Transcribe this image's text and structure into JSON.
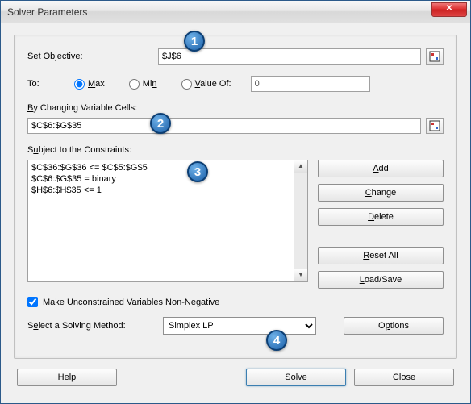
{
  "window": {
    "title": "Solver Parameters"
  },
  "objective": {
    "label": "Set Objective:",
    "value": "$J$6"
  },
  "to": {
    "label": "To:",
    "max_label": "Max",
    "min_label": "Min",
    "valueof_label": "Value Of:",
    "valueof_value": "0"
  },
  "changing": {
    "label": "By Changing Variable Cells:",
    "value": "$C$6:$G$35"
  },
  "constraints": {
    "label": "Subject to the Constraints:",
    "items": [
      "$C$36:$G$36 <= $C$5:$G$5",
      "$C$6:$G$35 = binary",
      "$H$6:$H$35 <= 1"
    ]
  },
  "buttons": {
    "add": "Add",
    "change": "Change",
    "delete": "Delete",
    "resetall": "Reset All",
    "loadsave": "Load/Save",
    "options": "Options",
    "help": "Help",
    "solve": "Solve",
    "close": "Close"
  },
  "nonneg": {
    "label": "Make Unconstrained Variables Non-Negative",
    "checked": true
  },
  "method": {
    "label": "Select a Solving Method:",
    "selected": "Simplex LP"
  },
  "badges": {
    "b1": "1",
    "b2": "2",
    "b3": "3",
    "b4": "4"
  }
}
